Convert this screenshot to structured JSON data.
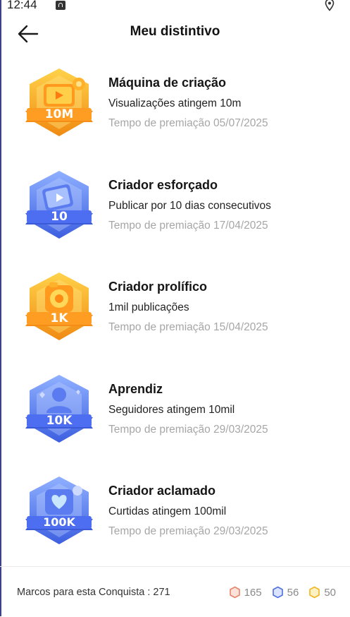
{
  "status_bar": {
    "time": "12:44",
    "app_icon": "notification-app-icon",
    "location_icon": "location-pin-icon"
  },
  "header": {
    "title": "Meu distintivo",
    "back_icon": "arrow-left-icon"
  },
  "badges": [
    {
      "name": "Máquina de criação",
      "description": "Visualizações atingem 10m",
      "awarded": "Tempo de premiação 05/07/2025",
      "badge_label": "10M",
      "tier": "gold"
    },
    {
      "name": "Criador esforçado",
      "description": "Publicar por 10 dias consecutivos",
      "awarded": "Tempo de premiação 17/04/2025",
      "badge_label": "10",
      "tier": "blue"
    },
    {
      "name": "Criador prolífico",
      "description": "1mil publicações",
      "awarded": "Tempo de premiação 15/04/2025",
      "badge_label": "1K",
      "tier": "gold"
    },
    {
      "name": "Aprendiz",
      "description": "Seguidores atingem 10mil",
      "awarded": "Tempo de premiação 29/03/2025",
      "badge_label": "10K",
      "tier": "blue"
    },
    {
      "name": "Criador aclamado",
      "description": "Curtidas atingem 100mil",
      "awarded": "Tempo de premiação 29/03/2025",
      "badge_label": "100K",
      "tier": "blue"
    }
  ],
  "footer": {
    "label": "Marcos para esta Conquista : 271",
    "counts": [
      {
        "icon": "bronze-hexagon-icon",
        "value": "165",
        "color": "#e8836b"
      },
      {
        "icon": "blue-hexagon-icon",
        "value": "56",
        "color": "#4f6fe0"
      },
      {
        "icon": "gold-hexagon-icon",
        "value": "50",
        "color": "#f2b51e"
      }
    ]
  },
  "colors": {
    "gold_light": "#ffc83a",
    "gold_dark": "#f08a12",
    "blue_light": "#7fa0ff",
    "blue_dark": "#3d5fe0",
    "muted_text": "#a6a6a6"
  }
}
